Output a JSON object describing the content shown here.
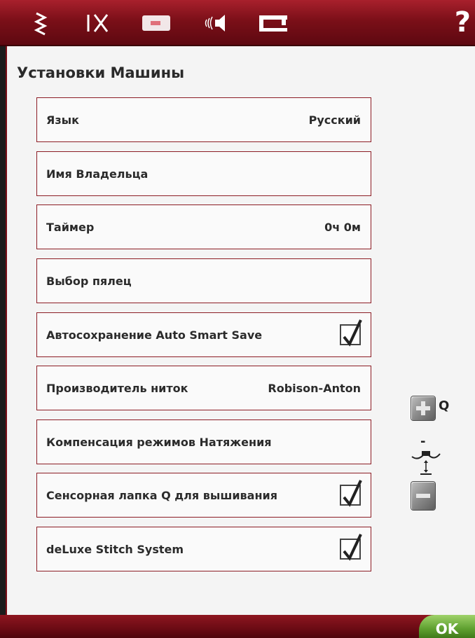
{
  "toolbar": {
    "help_label": "?"
  },
  "page": {
    "title": "Установки Машины"
  },
  "settings": [
    {
      "label": "Язык",
      "value": "Русский"
    },
    {
      "label": "Имя Владельца",
      "value": ""
    },
    {
      "label": "Таймер",
      "value": "0ч 0м"
    },
    {
      "label": "Выбор пялец",
      "value": ""
    },
    {
      "label": "Автосохранение Auto Smart Save",
      "checked": true
    },
    {
      "label": "Производитель ниток",
      "value": "Robison-Anton"
    },
    {
      "label": "Компенсация режимов Натяжения",
      "value": ""
    },
    {
      "label": "Сенсорная лапка Q для вышивания",
      "checked": true
    },
    {
      "label": "deLuxe Stitch System",
      "checked": true
    }
  ],
  "foot_height": {
    "q_label": "Q",
    "minus_label": "-"
  },
  "footer": {
    "ok_label": "OK"
  },
  "colors": {
    "brand": "#7a0f18",
    "ok": "#5fa030"
  }
}
